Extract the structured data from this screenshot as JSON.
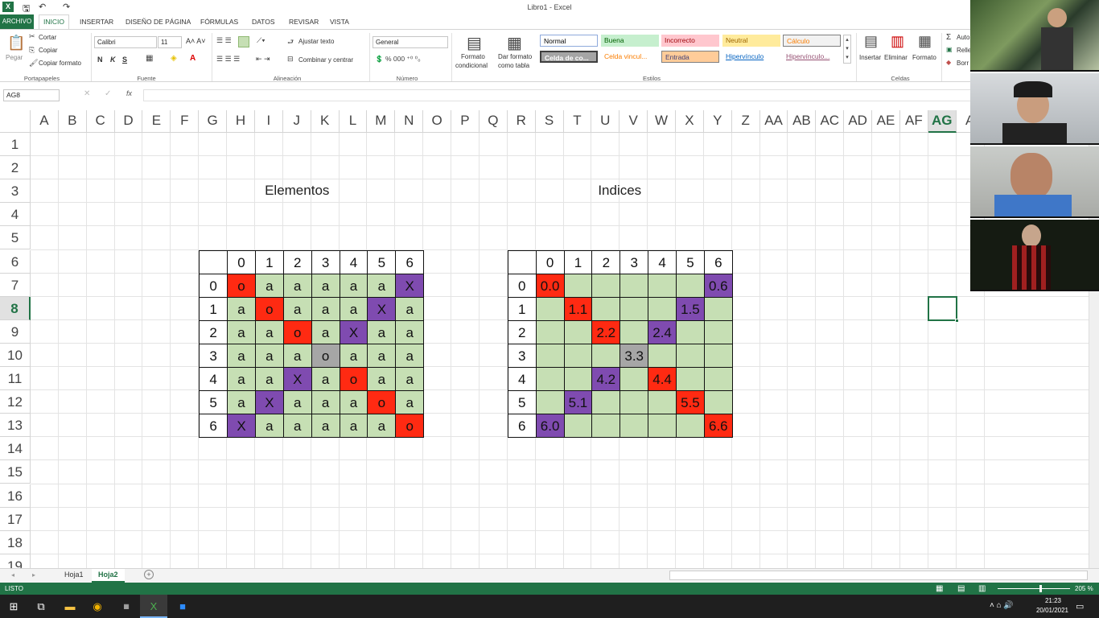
{
  "window": {
    "title": "Libro1 - Excel",
    "app_icon": "excel-icon"
  },
  "tabs": [
    "ARCHIVO",
    "INICIO",
    "INSERTAR",
    "DISEÑO DE PÁGINA",
    "FÓRMULAS",
    "DATOS",
    "REVISAR",
    "VISTA"
  ],
  "ribbon": {
    "clipboard": {
      "paste": "Pegar",
      "cut": "Cortar",
      "copy": "Copiar",
      "format_painter": "Copiar formato",
      "group": "Portapapeles"
    },
    "font": {
      "name": "Calibri",
      "size": "11",
      "bold": "N",
      "italic": "K",
      "underline": "S",
      "group": "Fuente"
    },
    "alignment": {
      "wrap": "Ajustar texto",
      "merge": "Combinar y centrar",
      "group": "Alineación"
    },
    "number": {
      "format": "General",
      "group": "Número"
    },
    "styles": {
      "cond_format": "Formato",
      "cond_format2": "condicional",
      "format_table": "Dar formato",
      "format_table2": "como tabla",
      "group": "Estilos",
      "normal": "Normal",
      "good": "Buena",
      "bad": "Incorrecto",
      "neutral": "Neutral",
      "calc": "Cálculo",
      "check": "Celda de co...",
      "linked": "Celda vincul...",
      "input": "Entrada",
      "hyperlink": "Hipervínculo",
      "followed": "Hipervínculo..."
    },
    "cells": {
      "insert": "Insertar",
      "delete": "Eliminar",
      "format": "Formato",
      "group": "Celdas"
    },
    "editing": {
      "autosum": "Auto",
      "fill": "Relle",
      "clear": "Borr"
    }
  },
  "formula_bar": {
    "name_box": "AG8",
    "fx": "fx",
    "content": ""
  },
  "columns": [
    "A",
    "B",
    "C",
    "D",
    "E",
    "F",
    "G",
    "H",
    "I",
    "J",
    "K",
    "L",
    "M",
    "N",
    "O",
    "P",
    "Q",
    "R",
    "S",
    "T",
    "U",
    "V",
    "W",
    "X",
    "Y",
    "Z",
    "AA",
    "AB",
    "AC",
    "AD",
    "AE",
    "AF",
    "AG",
    "A"
  ],
  "selected_column": "AG",
  "rows": [
    "1",
    "2",
    "3",
    "4",
    "5",
    "6",
    "7",
    "8",
    "9",
    "10",
    "11",
    "12",
    "13",
    "14",
    "15",
    "16",
    "17",
    "18",
    "19"
  ],
  "selected_row": "8",
  "sheet": {
    "heading_left": "Elementos",
    "heading_right": "Indices",
    "header_nums": [
      "0",
      "1",
      "2",
      "3",
      "4",
      "5",
      "6"
    ],
    "elementos": [
      [
        "o",
        "a",
        "a",
        "a",
        "a",
        "a",
        "X"
      ],
      [
        "a",
        "o",
        "a",
        "a",
        "a",
        "X",
        "a"
      ],
      [
        "a",
        "a",
        "o",
        "a",
        "X",
        "a",
        "a"
      ],
      [
        "a",
        "a",
        "a",
        "o",
        "a",
        "a",
        "a"
      ],
      [
        "a",
        "a",
        "X",
        "a",
        "o",
        "a",
        "a"
      ],
      [
        "a",
        "X",
        "a",
        "a",
        "a",
        "o",
        "a"
      ],
      [
        "X",
        "a",
        "a",
        "a",
        "a",
        "a",
        "o"
      ]
    ],
    "elementos_colors": [
      [
        "red",
        "green",
        "green",
        "green",
        "green",
        "green",
        "purple"
      ],
      [
        "green",
        "red",
        "green",
        "green",
        "green",
        "purple",
        "green"
      ],
      [
        "green",
        "green",
        "red",
        "green",
        "purple",
        "green",
        "green"
      ],
      [
        "green",
        "green",
        "green",
        "gray",
        "green",
        "green",
        "green"
      ],
      [
        "green",
        "green",
        "purple",
        "green",
        "red",
        "green",
        "green"
      ],
      [
        "green",
        "purple",
        "green",
        "green",
        "green",
        "red",
        "green"
      ],
      [
        "purple",
        "green",
        "green",
        "green",
        "green",
        "green",
        "red"
      ]
    ],
    "indices": [
      [
        "0.0",
        "",
        "",
        "",
        "",
        "",
        "0.6"
      ],
      [
        "",
        "1.1",
        "",
        "",
        "",
        "1.5",
        ""
      ],
      [
        "",
        "",
        "2.2",
        "",
        "2.4",
        "",
        ""
      ],
      [
        "",
        "",
        "",
        "3.3",
        "",
        "",
        ""
      ],
      [
        "",
        "",
        "4.2",
        "",
        "4.4",
        "",
        ""
      ],
      [
        "",
        "5.1",
        "",
        "",
        "",
        "5.5",
        ""
      ],
      [
        "6.0",
        "",
        "",
        "",
        "",
        "",
        "6.6"
      ]
    ]
  },
  "sheet_tabs": [
    "Hoja1",
    "Hoja2"
  ],
  "active_sheet": "Hoja2",
  "status": {
    "mode": "LISTO",
    "zoom": "205 %"
  },
  "taskbar": {
    "time": "21:23",
    "date": "20/01/2021"
  },
  "colors": {
    "excel_green": "#217346",
    "red": "#ff2a12",
    "green": "#c6dfb4",
    "purple": "#7f4bb0",
    "gray": "#a6a6a6"
  }
}
